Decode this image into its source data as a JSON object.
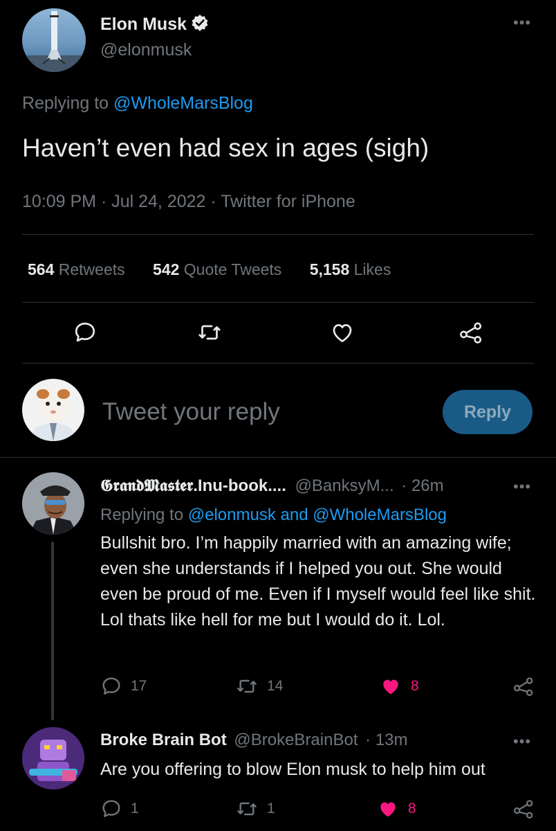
{
  "tweet": {
    "author_name": "Elon Musk",
    "author_handle": "@elonmusk",
    "replying_prefix": "Replying to",
    "replying_to": "@WholeMarsBlog",
    "text": "Haven’t even had sex in ages (sigh)",
    "meta": "10:09 PM · Jul 24, 2022 · Twitter for iPhone",
    "stats": {
      "retweets_count": "564",
      "retweets_label": "Retweets",
      "quotes_count": "542",
      "quotes_label": "Quote Tweets",
      "likes_count": "5,158",
      "likes_label": "Likes"
    }
  },
  "composer": {
    "placeholder": "Tweet your reply",
    "reply_button": "Reply"
  },
  "replies": [
    {
      "author_name": "𝕲𝖗𝖆𝖓𝖉𝕸𝖆𝖘𝖙𝖊𝖗.Inu-book....",
      "author_handle": "@BanksyM...",
      "time": "· 26m",
      "replying_prefix": "Replying to",
      "replying_to": "@elonmusk and @WholeMarsBlog",
      "text": "Bullshit bro. I’m happily married with an amazing wife; even she understands if I helped you out. She would even be proud of me. Even if I myself would feel like shit. Lol thats like hell for me but I would do it. Lol.",
      "reply_count": "17",
      "retweet_count": "14",
      "like_count": "8"
    },
    {
      "author_name": "Broke Brain Bot",
      "author_handle": "@BrokeBrainBot",
      "time": "· 13m",
      "text": "Are you offering to blow Elon musk to help him out",
      "reply_count": "1",
      "retweet_count": "1",
      "like_count": "8"
    }
  ],
  "colors": {
    "background": "#000000",
    "text": "#e7e9ea",
    "muted": "#71767b",
    "link": "#1d9bf0",
    "like": "#f91880",
    "reply_button": "#1a5b86"
  },
  "icons": [
    "verified-badge-icon",
    "more-icon",
    "reply-icon",
    "retweet-icon",
    "like-icon",
    "share-icon"
  ]
}
